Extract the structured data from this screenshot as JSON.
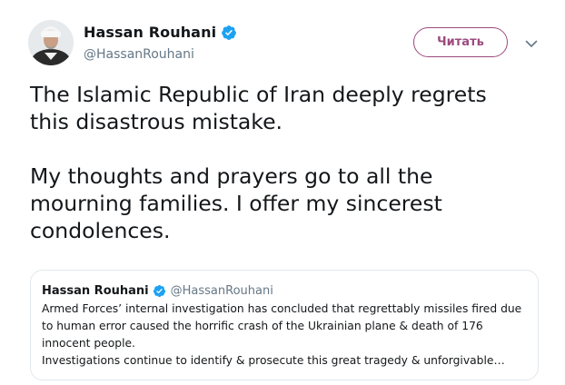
{
  "tweet": {
    "author": {
      "display_name": "Hassan Rouhani",
      "handle": "@HassanRouhani",
      "verified_icon": "verified-badge-icon"
    },
    "follow_label": "Читать",
    "more_icon": "chevron-down-icon",
    "text": "The Islamic Republic of Iran deeply regrets\nthis disastrous mistake.\n\nMy thoughts and prayers go to all the\nmourning families. I offer my sincerest\ncondolences."
  },
  "quoted_tweet": {
    "display_name": "Hassan Rouhani",
    "handle": "@HassanRouhani",
    "text": "Armed Forces’ internal investigation has concluded that regrettably missiles fired due\nto human error caused the horrific crash of the Ukrainian plane & death of 176\ninnocent people.\nInvestigations continue to identify & prosecute this great tragedy & unforgivable…"
  },
  "colors": {
    "accent": "#9c4b7e",
    "verified": "#1da1f2",
    "secondary_text": "#657786",
    "border": "#e1e8ed"
  }
}
